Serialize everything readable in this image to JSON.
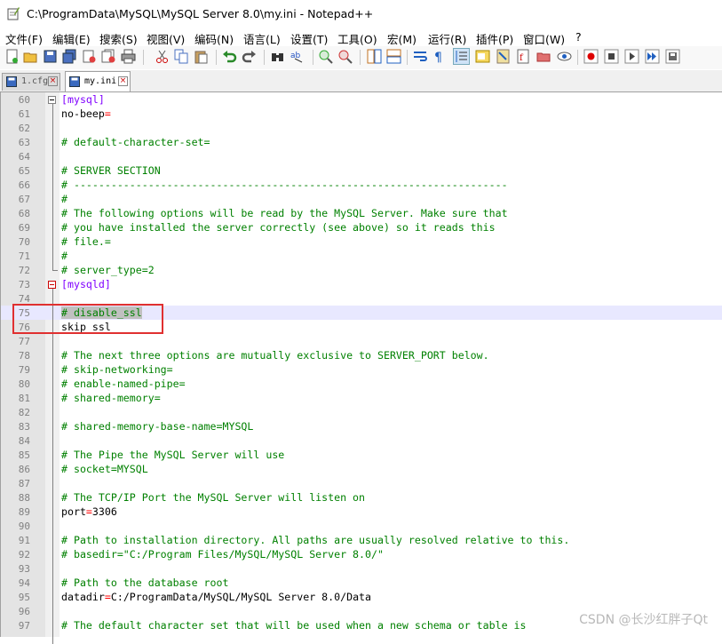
{
  "window": {
    "title": "C:\\ProgramData\\MySQL\\MySQL Server 8.0\\my.ini - Notepad++"
  },
  "menu": [
    "文件(F)",
    "编辑(E)",
    "搜索(S)",
    "视图(V)",
    "编码(N)",
    "语言(L)",
    "设置(T)",
    "工具(O)",
    "宏(M)",
    "运行(R)",
    "插件(P)",
    "窗口(W)",
    "?"
  ],
  "tabs": [
    {
      "label": "1.cfg",
      "active": false
    },
    {
      "label": "my.ini",
      "active": true
    }
  ],
  "editor": {
    "lines": [
      {
        "n": "60",
        "kind": "section",
        "text": "[mysql]"
      },
      {
        "n": "61",
        "kind": "kv",
        "key": "no-beep",
        "value": ""
      },
      {
        "n": "62",
        "kind": "blank",
        "text": ""
      },
      {
        "n": "63",
        "kind": "comment",
        "text": "# default-character-set="
      },
      {
        "n": "64",
        "kind": "blank",
        "text": ""
      },
      {
        "n": "65",
        "kind": "comment",
        "text": "# SERVER SECTION"
      },
      {
        "n": "66",
        "kind": "comment",
        "text": "# ----------------------------------------------------------------------"
      },
      {
        "n": "67",
        "kind": "comment",
        "text": "#"
      },
      {
        "n": "68",
        "kind": "comment",
        "text": "# The following options will be read by the MySQL Server. Make sure that"
      },
      {
        "n": "69",
        "kind": "comment",
        "text": "# you have installed the server correctly (see above) so it reads this"
      },
      {
        "n": "70",
        "kind": "comment",
        "text": "# file.="
      },
      {
        "n": "71",
        "kind": "comment",
        "text": "#"
      },
      {
        "n": "72",
        "kind": "comment",
        "text": "# server_type=2"
      },
      {
        "n": "73",
        "kind": "section",
        "text": "[mysqld]"
      },
      {
        "n": "74",
        "kind": "blank",
        "text": ""
      },
      {
        "n": "75",
        "kind": "comment-selected",
        "text": "# disable_ssl"
      },
      {
        "n": "76",
        "kind": "plain",
        "text": "skip_ssl"
      },
      {
        "n": "77",
        "kind": "blank",
        "text": ""
      },
      {
        "n": "78",
        "kind": "comment",
        "text": "# The next three options are mutually exclusive to SERVER_PORT below."
      },
      {
        "n": "79",
        "kind": "comment",
        "text": "# skip-networking="
      },
      {
        "n": "80",
        "kind": "comment",
        "text": "# enable-named-pipe="
      },
      {
        "n": "81",
        "kind": "comment",
        "text": "# shared-memory="
      },
      {
        "n": "82",
        "kind": "blank",
        "text": ""
      },
      {
        "n": "83",
        "kind": "comment",
        "text": "# shared-memory-base-name=MYSQL"
      },
      {
        "n": "84",
        "kind": "blank",
        "text": ""
      },
      {
        "n": "85",
        "kind": "comment",
        "text": "# The Pipe the MySQL Server will use"
      },
      {
        "n": "86",
        "kind": "comment",
        "text": "# socket=MYSQL"
      },
      {
        "n": "87",
        "kind": "blank",
        "text": ""
      },
      {
        "n": "88",
        "kind": "comment",
        "text": "# The TCP/IP Port the MySQL Server will listen on"
      },
      {
        "n": "89",
        "kind": "kv",
        "key": "port",
        "value": "3306"
      },
      {
        "n": "90",
        "kind": "blank",
        "text": ""
      },
      {
        "n": "91",
        "kind": "comment",
        "text": "# Path to installation directory. All paths are usually resolved relative to this."
      },
      {
        "n": "92",
        "kind": "comment",
        "text": "# basedir=\"C:/Program Files/MySQL/MySQL Server 8.0/\""
      },
      {
        "n": "93",
        "kind": "blank",
        "text": ""
      },
      {
        "n": "94",
        "kind": "comment",
        "text": "# Path to the database root"
      },
      {
        "n": "95",
        "kind": "kv",
        "key": "datadir",
        "value": "C:/ProgramData/MySQL/MySQL Server 8.0/Data"
      },
      {
        "n": "96",
        "kind": "blank",
        "text": ""
      },
      {
        "n": "97",
        "kind": "comment",
        "text": "# The default character set that will be used when a new schema or table is"
      }
    ]
  },
  "watermark": "CSDN @长沙红胖子Qt",
  "colors": {
    "comment": "#008000",
    "section": "#8000ff",
    "operator": "#ff0000",
    "annotation_box": "#e03030"
  }
}
